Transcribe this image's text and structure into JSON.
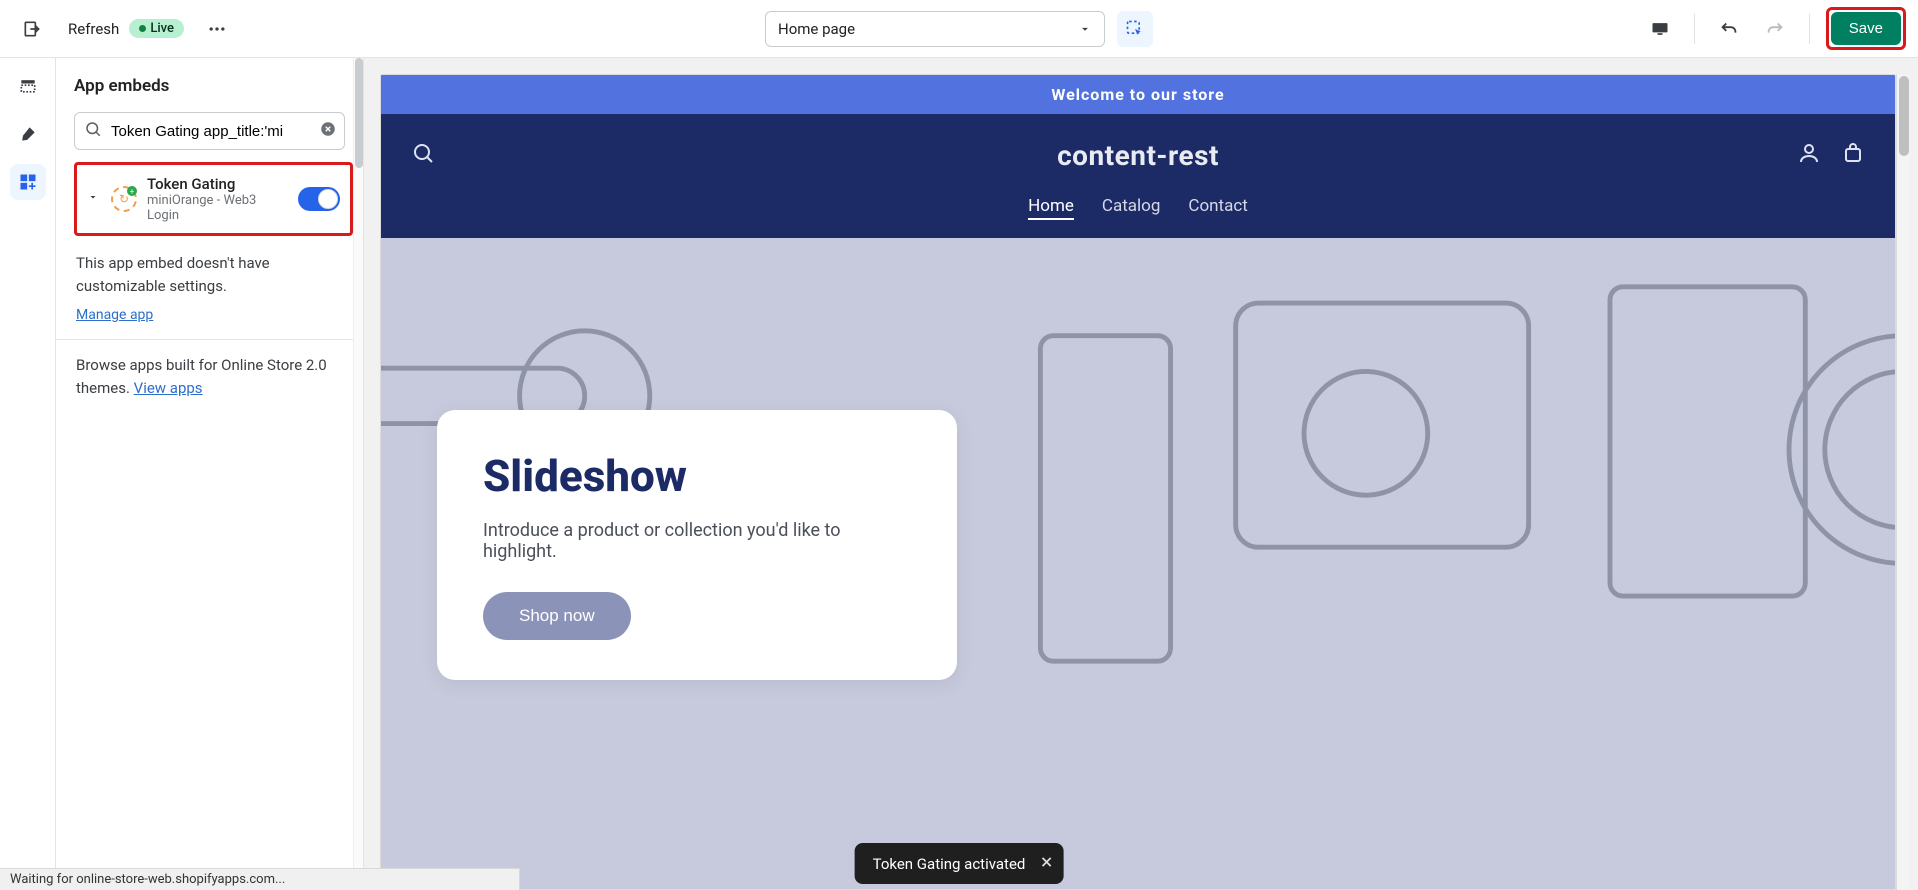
{
  "topbar": {
    "refresh_label": "Refresh",
    "live_label": "Live",
    "page_select_label": "Home page",
    "save_label": "Save"
  },
  "sidebar": {
    "title": "App embeds",
    "search_value": "Token Gating app_title:'mi",
    "embed": {
      "title": "Token Gating",
      "subtitle": "miniOrange - Web3 Login"
    },
    "no_settings_note": "This app embed doesn't have customizable settings.",
    "manage_link": "Manage app",
    "browse_note_prefix": "Browse apps built for Online Store 2.0 themes. ",
    "view_apps_link": "View apps"
  },
  "store": {
    "announcement": "Welcome to our store",
    "brand": "content-rest",
    "nav": {
      "home": "Home",
      "catalog": "Catalog",
      "contact": "Contact"
    },
    "hero": {
      "title": "Slideshow",
      "subtitle": "Introduce a product or collection you'd like to highlight.",
      "cta": "Shop now"
    }
  },
  "toast": {
    "message": "Token Gating activated"
  },
  "status": {
    "text": "Waiting for online-store-web.shopifyapps.com..."
  }
}
